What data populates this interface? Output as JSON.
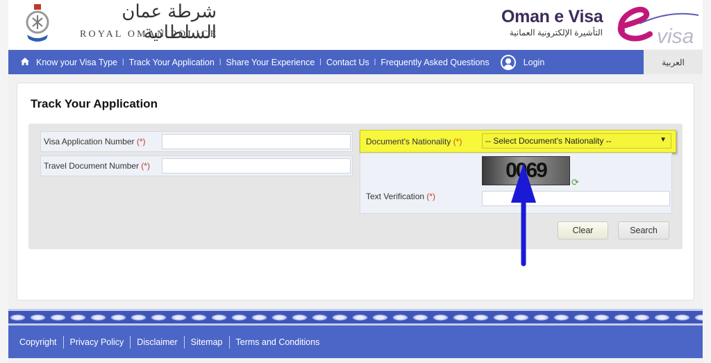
{
  "header": {
    "police_arabic": "شرطة عمان السلطانية",
    "police_english": "ROYAL OMAN POLICE",
    "evisa_title": "Oman e Visa",
    "evisa_arabic": "التأشيرة الإلكترونية العمانية",
    "evisa_logo_text": "visa"
  },
  "nav": {
    "home_icon": "home-icon",
    "items": [
      {
        "label": "Know your Visa Type"
      },
      {
        "label": "Track Your Application"
      },
      {
        "label": "Share Your Experience"
      },
      {
        "label": "Contact Us"
      },
      {
        "label": "Frequently Asked Questions"
      }
    ],
    "separator": "|",
    "login_label": "Login",
    "language_label": "العربية"
  },
  "main": {
    "title": "Track Your Application",
    "fields": {
      "visa_app_number": {
        "label": "Visa Application Number",
        "required_mark": "(*)",
        "value": ""
      },
      "travel_doc_number": {
        "label": "Travel Document Number",
        "required_mark": "(*)",
        "value": ""
      },
      "nationality": {
        "label": "Document's Nationality",
        "required_mark": "(*)",
        "selected": "-- Select Document's Nationality --"
      },
      "text_verification": {
        "label": "Text Verification",
        "required_mark": "(*)",
        "value": ""
      }
    },
    "captcha_text": "0069",
    "buttons": {
      "clear": "Clear",
      "search": "Search"
    },
    "annotation_color": "#1a1ad6",
    "highlight_color": "#f7f73c"
  },
  "footer": {
    "links": [
      {
        "label": "Copyright"
      },
      {
        "label": "Privacy Policy"
      },
      {
        "label": "Disclaimer"
      },
      {
        "label": "Sitemap"
      },
      {
        "label": "Terms and Conditions"
      }
    ]
  },
  "colors": {
    "brand_blue": "#4a64c4",
    "evisa_magenta": "#c2187a"
  }
}
